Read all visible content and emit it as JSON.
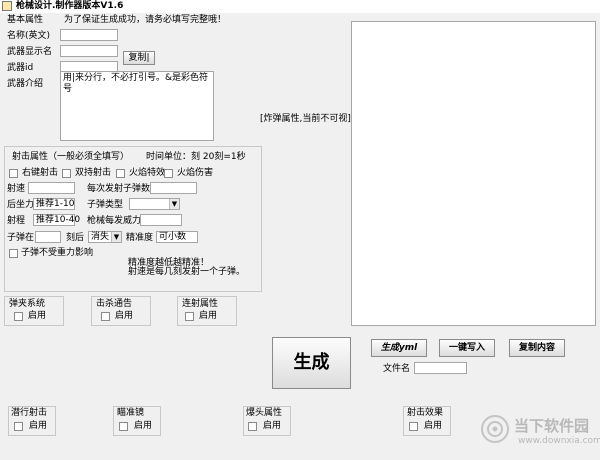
{
  "window": {
    "title": "枪械设计.制作器版本V1.6"
  },
  "basic": {
    "section_label": "基本属性",
    "hint": "为了保证生成成功，请务必填写完整哦！",
    "name_label": "名称(英文)",
    "display_name_label": "武器显示名",
    "id_label": "武器id",
    "copy_button": "复制|",
    "intro_label": "武器介绍",
    "intro_value": "用|来分行，不必打引号。&是彩色符号"
  },
  "explosion_label": "[炸弹属性,当前不可视]",
  "shoot": {
    "title": "射击属性（一般必须全填写）",
    "time_unit": "时间单位：刻 20刻=1秒",
    "checkboxes": [
      "右键射击",
      "双持射击",
      "火焰特效",
      "火焰伤害"
    ],
    "speed_label": "射速",
    "bullets_per_shot_label": "每次发射子弹数",
    "recoil_label": "后坐力",
    "recoil_hint": "推荐1-10",
    "bullet_type_label": "子弹类型",
    "range_label": "射程",
    "range_hint": "推荐10-40",
    "power_label": "枪械每发威力",
    "bullet_in_label": "子弹在",
    "ticks_after_label": "刻后",
    "vanish_option": "消失",
    "accuracy_label": "精准度",
    "accuracy_hint": "可小数",
    "no_gravity_label": "子弹不受重力影响",
    "accuracy_note_1": "精准度越低越精准！",
    "accuracy_note_2": "射速是每几刻发射一个子弹。"
  },
  "modules": {
    "enable_label": "启用",
    "clip_system": "弹夹系统",
    "kill_notice": "击杀通告",
    "burst": "连射属性",
    "sneak_shoot": "潜行射击",
    "scope": "瞄准镜",
    "headshot": "爆头属性",
    "shoot_effect": "射击效果"
  },
  "actions": {
    "generate": "生成",
    "generate_yml": "生成yml",
    "one_click_write": "一键写入",
    "copy_content": "复制内容",
    "filename_label": "文件名"
  },
  "watermark": {
    "brand": "当下软件园",
    "url": "www.downxia.com"
  }
}
